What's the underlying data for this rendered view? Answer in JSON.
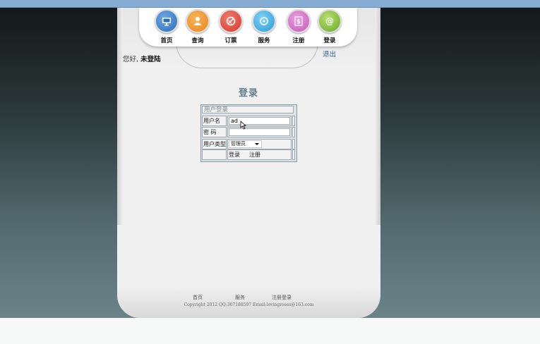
{
  "nav": {
    "items": [
      {
        "label": "首页",
        "icon": "monitor-icon",
        "color": "#2b6cb3"
      },
      {
        "label": "查询",
        "icon": "person-icon",
        "color": "#e8851c"
      },
      {
        "label": "订票",
        "icon": "ball-icon",
        "color": "#d33a2c"
      },
      {
        "label": "服务",
        "icon": "disc-icon",
        "color": "#2a9bd6"
      },
      {
        "label": "注册",
        "icon": "dollar-icon",
        "color": "#c45bb8"
      },
      {
        "label": "登录",
        "icon": "at-icon",
        "color": "#6aa82a"
      }
    ]
  },
  "header": {
    "greeting_prefix": "您好,",
    "greeting_user": "未登陆",
    "logout": "退出"
  },
  "form": {
    "title": "登录",
    "table_header": "用户登录",
    "username_label": "用户名",
    "username_value": "ad",
    "password_label": "密 码",
    "password_value": "",
    "usertype_label": "用户类型",
    "usertype_selected": "管理员",
    "submit": "登录",
    "register": "注册"
  },
  "footer": {
    "links": [
      "首页",
      "服务",
      "注册登录"
    ],
    "copyright": "Copyright 2012 QQ:307188597 Email:lovingroses@163.com"
  },
  "colors": {
    "topbar": "#86aed4",
    "title": "#607d8b",
    "link": "#2a5d9a"
  }
}
